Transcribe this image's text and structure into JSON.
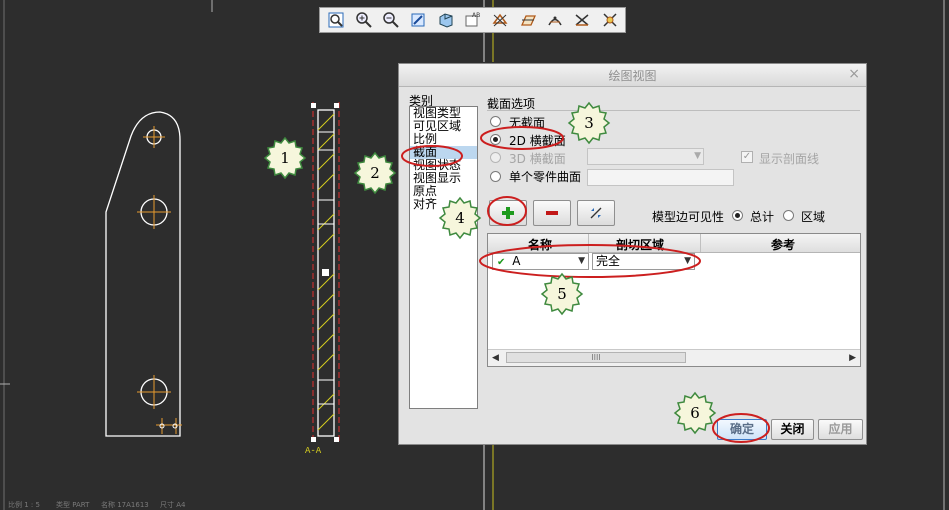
{
  "toolbar": {
    "icons": [
      "refit-icon",
      "zoom-in-icon",
      "zoom-out-icon",
      "repaint-icon",
      "shading-icon",
      "annotation-display-icon",
      "datum-planes-icon",
      "datum-axes-icon",
      "datum-points-icon",
      "coordinate-systems-icon"
    ]
  },
  "drawing": {
    "section_label": "A-A"
  },
  "dialog": {
    "title": "绘图视图",
    "close_glyph": "×",
    "category_label": "类别",
    "categories": [
      "视图类型",
      "可见区域",
      "比例",
      "截面",
      "视图状态",
      "视图显示",
      "原点",
      "对齐"
    ],
    "selected_category": "截面",
    "section_options_title": "截面选项",
    "radio_none": "无截面",
    "radio_2d": "2D 横截面",
    "radio_3d": "3D 横截面",
    "radio_surface": "单个零件曲面",
    "show_section_lines": "显示剖面线",
    "model_edge_visibility": "模型边可见性",
    "vis_total": "总计",
    "vis_area": "区域",
    "table": {
      "col_name": "名称",
      "col_cut": "剖切区域",
      "col_ref": "参考",
      "row_name": "A",
      "row_cut": "完全",
      "scroll_thumb": "IIII"
    },
    "btn_ok": "确定",
    "btn_close": "关闭",
    "btn_apply": "应用"
  },
  "callouts": [
    "1",
    "2",
    "3",
    "4",
    "5",
    "6"
  ],
  "status_bar": [
    "比例 1 : 5",
    "类型 PART",
    "名称 17A1613",
    "尺寸 A4"
  ],
  "colors": {
    "canvas": "#2d2d2d",
    "outline": "#ffffff",
    "center_mark": "#e69a2e",
    "hatch": "#d8d020",
    "cut_line": "#e03030",
    "annotation_red": "#cc1f1f",
    "callout_fill": "#f6f6dc",
    "callout_edge": "#3f8a3f"
  }
}
